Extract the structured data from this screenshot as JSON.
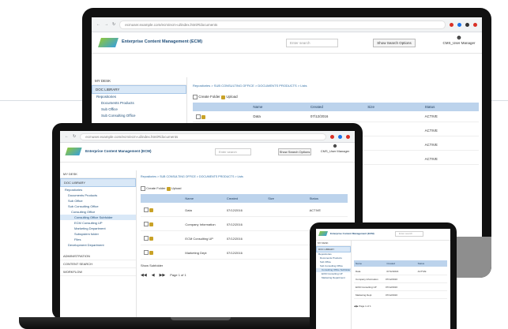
{
  "app": {
    "title": "Enterprise Content Management (ECM)",
    "search_placeholder": "Enter search",
    "search_button": "Show Search Options",
    "user_label": "CMS_User Manager"
  },
  "browser": {
    "url": "ecmuser.example.com/ecm/ecm-ui/index.html#/documents"
  },
  "sidebar": {
    "my_desk": "MY DESK",
    "doc_library": "DOC LIBRARY",
    "tree": [
      "Repositories",
      "Documents Products",
      "Sub Office",
      "Sub Consulting Office"
    ]
  },
  "breadcrumb": "Repositories > SUB CONSULTING OFFICE > DOCUMENTS PRODUCTS > Lists",
  "toolbar": {
    "create_folder": "Create Folder",
    "upload": "Upload"
  },
  "grid": {
    "headers": [
      "",
      "Name",
      "Created",
      "Size",
      "Status"
    ],
    "rows": [
      {
        "name": "Data",
        "created": "07/12/2016",
        "size": "",
        "status": "ACTIVE"
      },
      {
        "name": "",
        "created": "07/12/2016",
        "size": "",
        "status": "ACTIVE"
      },
      {
        "name": "",
        "created": "07/12/2016",
        "size": "",
        "status": "ACTIVE"
      },
      {
        "name": "",
        "created": "07/12/2016",
        "size": "",
        "status": "ACTIVE"
      }
    ]
  },
  "laptop": {
    "tree": [
      "Repositories",
      "Documents Products",
      "Sub Office",
      "Sub Consulting Office",
      "Consulting Office",
      "Consulting Office Subfolder",
      "ECM Consulting UP",
      "Marketing Department",
      "Subsystem folder",
      "Files",
      "Development Department"
    ],
    "sections": [
      "ADMINISTRATION",
      "CONTENT SEARCH",
      "WORKFLOW"
    ],
    "rows": [
      {
        "name": "Data",
        "created": "07/12/2016",
        "status": "ACTIVE"
      },
      {
        "name": "Company Information",
        "created": "07/12/2016"
      },
      {
        "name": "ECM Consulting UP",
        "created": "07/12/2016"
      },
      {
        "name": "Marketing Dept",
        "created": "07/12/2016"
      }
    ],
    "footer": "Show Subfolder",
    "pager": "Page 1 of 1"
  },
  "colors": {
    "accent": "#2e6da4",
    "grid_header": "#bcd3ec",
    "active": "#d9e8f7"
  }
}
